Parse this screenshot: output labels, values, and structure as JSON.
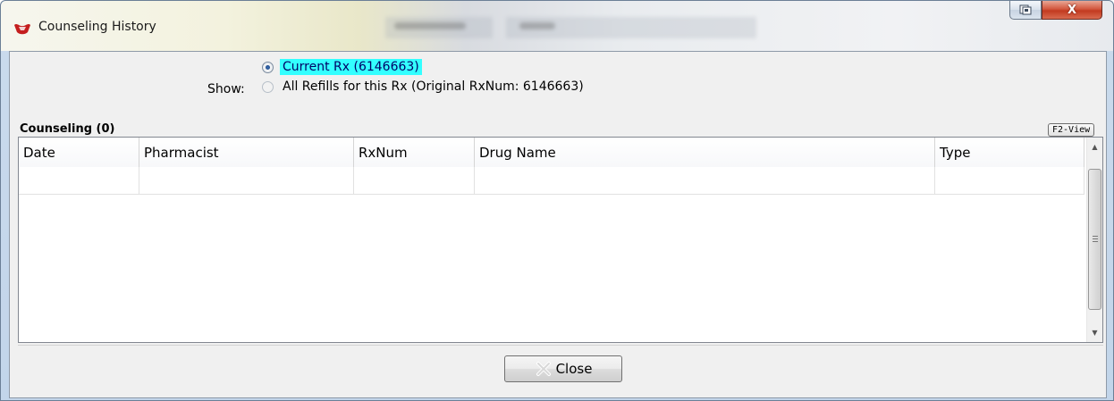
{
  "window": {
    "title": "Counseling History",
    "close_glyph": "X",
    "restore_icon": "restore-window-icon",
    "app_icon": "pill-app-icon"
  },
  "show": {
    "label": "Show:",
    "options": [
      {
        "label": "Current Rx (6146663)",
        "selected": true
      },
      {
        "label": "All Refills for this Rx (Original RxNum: 6146663)",
        "selected": false
      }
    ]
  },
  "counseling": {
    "section_label": "Counseling (0)",
    "view_button": "F2-View",
    "columns": [
      "Date",
      "Pharmacist",
      "RxNum",
      "Drug Name",
      "Type"
    ],
    "rows": []
  },
  "footer": {
    "close_label": "Close"
  },
  "colors": {
    "highlight": "#33ffff",
    "close_button_red": "#c23a20"
  }
}
